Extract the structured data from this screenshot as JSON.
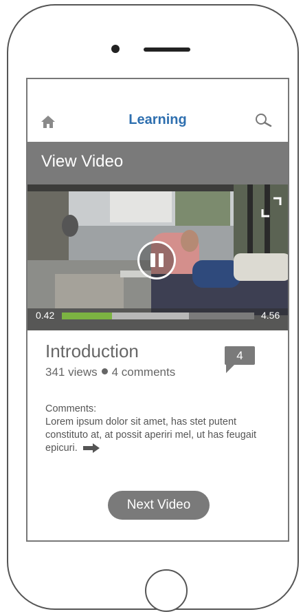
{
  "app": {
    "title": "Learning"
  },
  "header": {
    "home_icon": "home-icon",
    "search_icon": "search-icon"
  },
  "section": {
    "title": "View Video"
  },
  "player": {
    "time_start": "0.42",
    "time_end": "4.56",
    "progress_played_fraction": 0.26,
    "progress_buffered_fraction": 0.66,
    "state_icon": "pause-icon",
    "fullscreen_icon": "fullscreen-icon",
    "colors": {
      "played": "#7cb342",
      "buffered": "#b8b8b8",
      "track": "#7b7b7b"
    }
  },
  "video": {
    "title": "Introduction",
    "views": "341 views",
    "comments_count_text": "4 comments",
    "badge_count": "4"
  },
  "comments": {
    "label": "Comments:",
    "text": "Lorem ipsum dolor sit amet, has stet putent constituto at, at possit aperiri mel, ut has feugait epicuri."
  },
  "actions": {
    "next_label": "Next Video"
  },
  "colors": {
    "accent": "#2e6faf",
    "bar": "#7a7a7a"
  }
}
